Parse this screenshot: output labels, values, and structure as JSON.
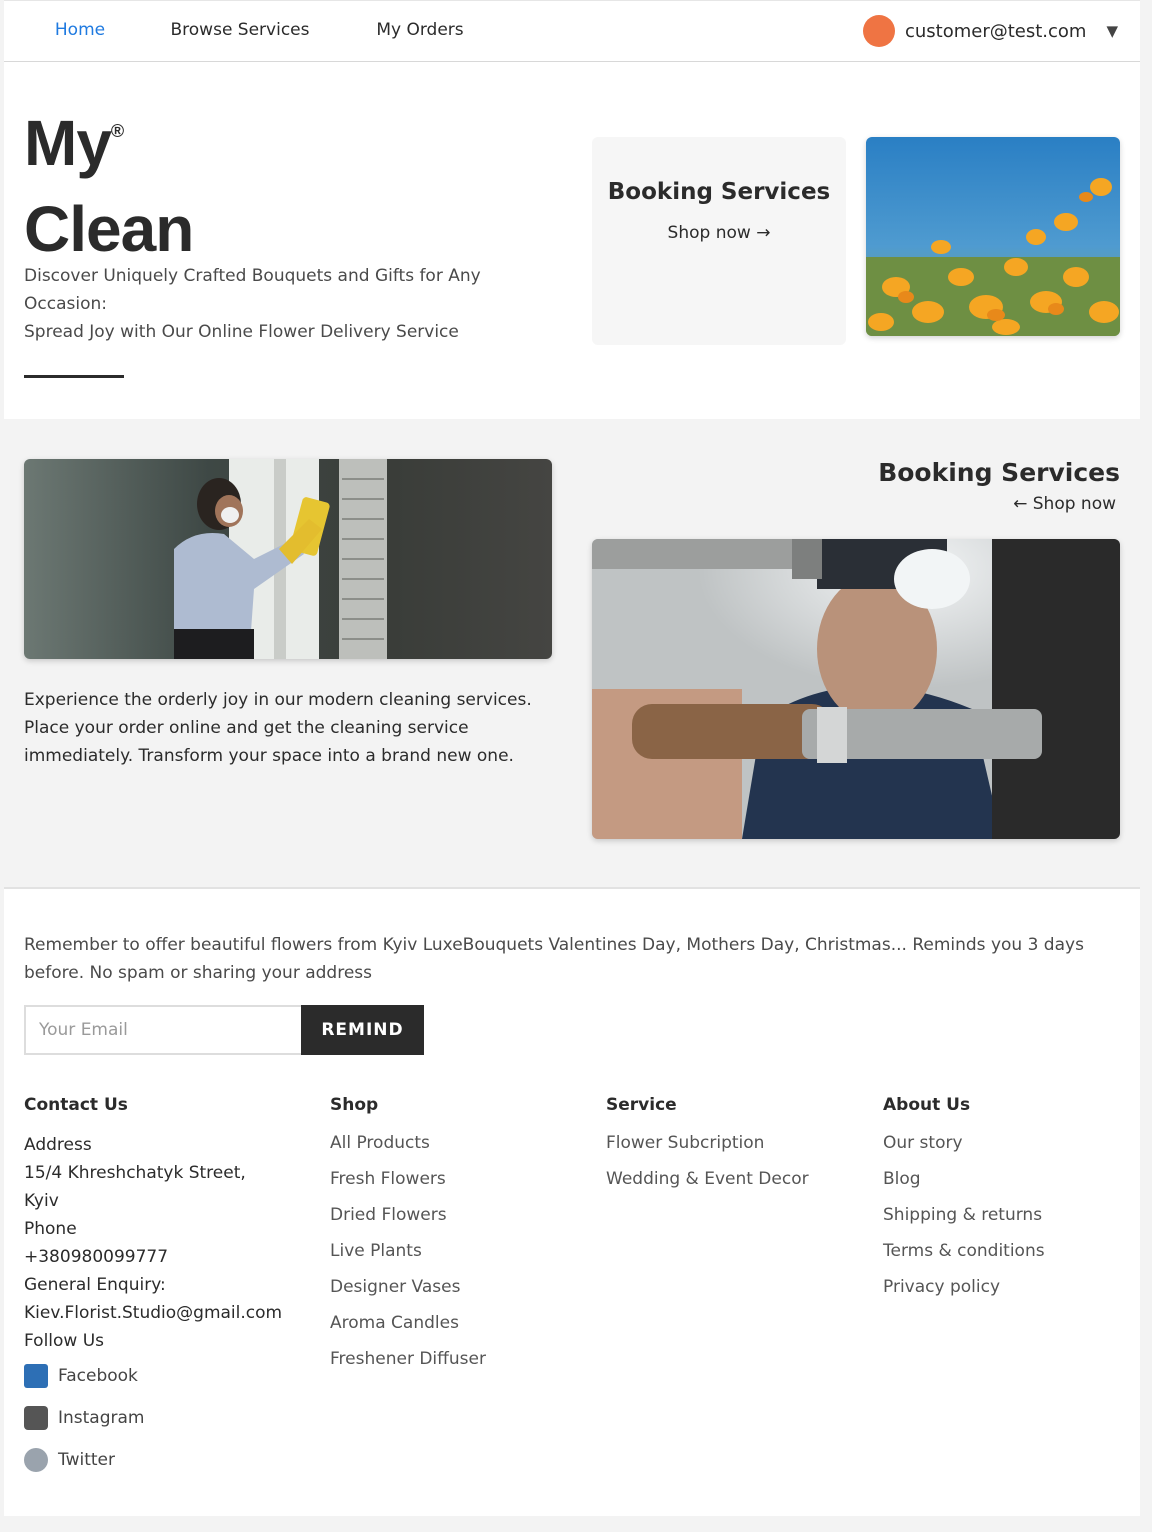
{
  "nav": {
    "items": [
      {
        "label": "Home",
        "active": true
      },
      {
        "label": "Browse Services",
        "active": false
      },
      {
        "label": "My Orders",
        "active": false
      }
    ],
    "user_email": "customer@test.com",
    "avatar_color": "#ef7443",
    "dropdown_icon": "caret-down-icon"
  },
  "hero": {
    "brand_line1": "My",
    "brand_mark": "®",
    "brand_line2": "Clean",
    "tagline_line1": "Discover Uniquely Crafted Bouquets and Gifts for Any Occasion:",
    "tagline_line2": "Spread Joy with Our Online Flower Delivery Service",
    "card_title": "Booking Services",
    "card_link": "Shop now →",
    "image_alt": "orange flowers field photo"
  },
  "section2": {
    "title": "Booking Services",
    "link": "← Shop now",
    "description": "Experience the orderly joy in our modern cleaning services. Place your order online and get the cleaning service immediately. Transform your space into a brand new one.",
    "image_left_alt": "person cleaning window photo",
    "image_right_alt": "technician with tool photo"
  },
  "footer": {
    "remind_text": "Remember to offer beautiful flowers from Kyiv LuxeBouquets Valentines Day, Mothers Day, Christmas... Reminds you 3 days before. No spam or sharing your address",
    "email_placeholder": "Your Email",
    "remind_button": "REMIND",
    "contact": {
      "heading": "Contact Us",
      "address_label": "Address",
      "address_line1": "15/4 Khreshchatyk Street,",
      "address_line2": "Kyiv",
      "phone_label": "Phone",
      "phone": "+380980099777",
      "enquiry_label": "General Enquiry:",
      "email": "Kiev.Florist.Studio@gmail.com",
      "follow_label": "Follow Us",
      "social": [
        {
          "label": "Facebook",
          "icon": "book-icon"
        },
        {
          "label": "Instagram",
          "icon": "camera-icon"
        },
        {
          "label": "Twitter",
          "icon": "bird-icon"
        }
      ]
    },
    "shop": {
      "heading": "Shop",
      "links": [
        "All Products",
        "Fresh Flowers",
        "Dried Flowers",
        "Live Plants",
        "Designer Vases",
        "Aroma Candles",
        "Freshener Diffuser"
      ]
    },
    "service": {
      "heading": "Service",
      "links": [
        "Flower Subcription",
        "Wedding & Event Decor"
      ]
    },
    "about": {
      "heading": "About Us",
      "links": [
        "Our story",
        "Blog",
        "Shipping & returns",
        "Terms & conditions",
        "Privacy policy"
      ]
    }
  }
}
